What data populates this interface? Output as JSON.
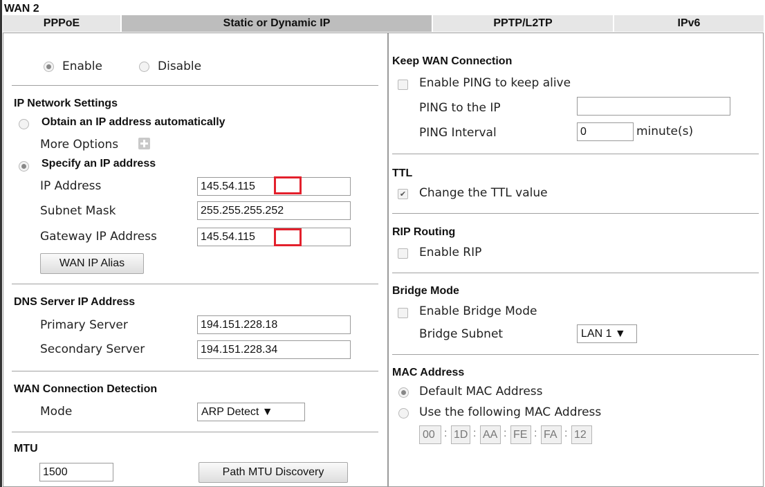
{
  "page": {
    "title": "WAN 2"
  },
  "tabs": [
    {
      "label": "PPPoE"
    },
    {
      "label": "Static or Dynamic IP",
      "active": true
    },
    {
      "label": "PPTP/L2TP"
    },
    {
      "label": "IPv6"
    }
  ],
  "left": {
    "enable_label": "Enable",
    "disable_label": "Disable",
    "enable_selected": true,
    "ip_network": {
      "heading": "IP Network Settings",
      "obtain_auto_label": "Obtain an IP address automatically",
      "more_options_label": "More Options",
      "specify_label": "Specify an IP address",
      "specify_selected": true,
      "ip_address_label": "IP Address",
      "ip_address_value": "145.54.115",
      "subnet_mask_label": "Subnet Mask",
      "subnet_mask_value": "255.255.255.252",
      "gateway_label": "Gateway IP Address",
      "gateway_value": "145.54.115",
      "wan_ip_alias_button": "WAN IP Alias"
    },
    "dns": {
      "heading": "DNS Server IP Address",
      "primary_label": "Primary Server",
      "primary_value": "194.151.228.18",
      "secondary_label": "Secondary Server",
      "secondary_value": "194.151.228.34"
    },
    "detection": {
      "heading": "WAN Connection Detection",
      "mode_label": "Mode",
      "mode_value": "ARP Detect ▼"
    },
    "mtu": {
      "heading": "MTU",
      "value": "1500",
      "path_mtu_button": "Path MTU Discovery"
    }
  },
  "right": {
    "keep_wan": {
      "heading": "Keep WAN Connection",
      "enable_ping_label": "Enable PING to keep alive",
      "ping_ip_label": "PING to the IP",
      "ping_ip_value": "",
      "ping_interval_label": "PING Interval",
      "ping_interval_value": "0",
      "ping_interval_unit": "minute(s)"
    },
    "ttl": {
      "heading": "TTL",
      "change_ttl_label": "Change the TTL value",
      "checked": true
    },
    "rip": {
      "heading": "RIP Routing",
      "enable_rip_label": "Enable RIP"
    },
    "bridge": {
      "heading": "Bridge Mode",
      "enable_bridge_label": "Enable Bridge Mode",
      "bridge_subnet_label": "Bridge Subnet",
      "bridge_subnet_value": "LAN 1 ▼"
    },
    "mac": {
      "heading": "MAC Address",
      "default_label": "Default MAC Address",
      "default_selected": true,
      "use_following_label": "Use the following MAC Address",
      "octets": [
        "00",
        "1D",
        "AA",
        "FE",
        "FA",
        "12"
      ],
      "separator": ":"
    }
  },
  "colors": {
    "highlight_red": "#e3202c",
    "active_tab": "#bdbdbd",
    "tab": "#e6e6e6"
  }
}
